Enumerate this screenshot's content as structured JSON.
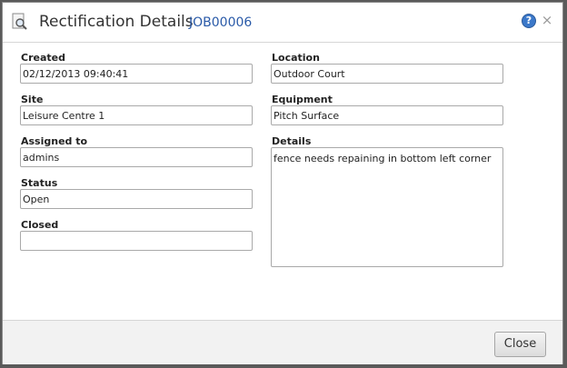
{
  "dialog": {
    "title": "Rectification Details",
    "job_code": "JOB00006",
    "icons": {
      "title": "magnifier-document-icon",
      "help": "help-icon",
      "close": "close-icon"
    },
    "help_glyph": "?",
    "close_glyph": "×"
  },
  "fields": {
    "created": {
      "label": "Created",
      "value": "02/12/2013 09:40:41"
    },
    "site": {
      "label": "Site",
      "value": "Leisure Centre 1"
    },
    "assigned_to": {
      "label": "Assigned to",
      "value": "admins"
    },
    "status": {
      "label": "Status",
      "value": "Open"
    },
    "closed": {
      "label": "Closed",
      "value": ""
    },
    "location": {
      "label": "Location",
      "value": "Outdoor Court"
    },
    "equipment": {
      "label": "Equipment",
      "value": "Pitch Surface"
    },
    "details": {
      "label": "Details",
      "value": "fence needs repaining in bottom left corner"
    }
  },
  "footer": {
    "close_label": "Close"
  },
  "colors": {
    "accent": "#2a5aa8",
    "help": "#3b78c9"
  }
}
